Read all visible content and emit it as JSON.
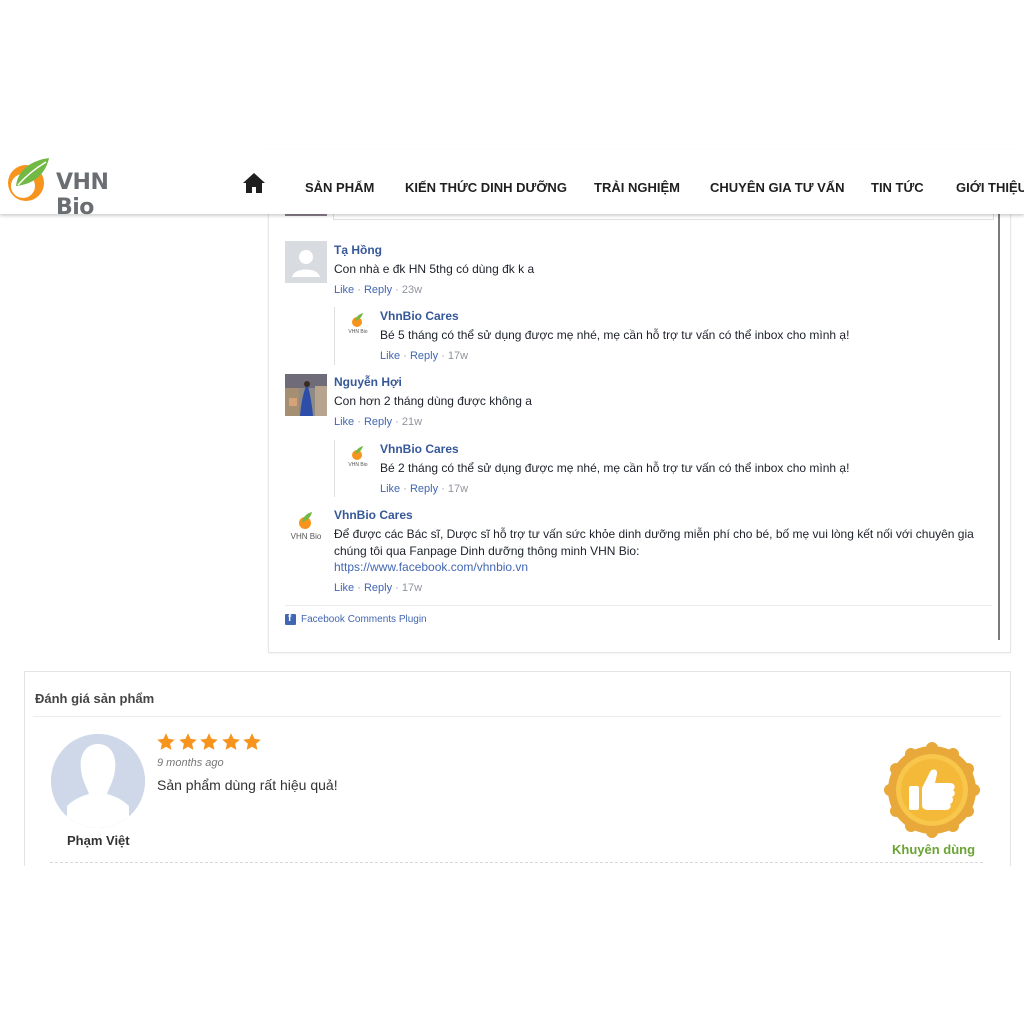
{
  "brand": {
    "name": "VHN Bio",
    "accent_orange": "#f7941d",
    "accent_green": "#72b844"
  },
  "nav": {
    "home_icon": "home-icon",
    "items": [
      "SẢN PHẨM",
      "KIẾN THỨC DINH DƯỠNG",
      "TRẢI NGHIỆM",
      "CHUYÊN GIA TƯ VẤN",
      "TIN TỨC",
      "GIỚI THIỆU"
    ]
  },
  "comments": [
    {
      "name": "Tạ Hồng",
      "text": "Con nhà e đk HN 5thg có dùng đk k a",
      "like": "Like",
      "reply": "Reply",
      "sep": "·",
      "time": "23w",
      "replies": [
        {
          "name": "VhnBio Cares",
          "text": "Bé 5 tháng có thể sử dụng được mẹ nhé, mẹ cần hỗ trợ tư vấn có thể inbox cho mình ạ!",
          "like": "Like",
          "reply": "Reply",
          "sep": "·",
          "time": "17w"
        }
      ]
    },
    {
      "name": "Nguyễn Hợi",
      "text": "Con hơn 2 tháng dùng được không a",
      "like": "Like",
      "reply": "Reply",
      "sep": "·",
      "time": "21w",
      "replies": [
        {
          "name": "VhnBio Cares",
          "text": "Bé 2 tháng có thể sử dụng được mẹ nhé, mẹ cần hỗ trợ tư vấn có thể inbox cho mình ạ!",
          "like": "Like",
          "reply": "Reply",
          "sep": "·",
          "time": "17w"
        }
      ]
    },
    {
      "name": "VhnBio Cares",
      "text_line1": "Để được các Bác sĩ, Dược sĩ hỗ trợ tư vấn sức khỏe dinh dưỡng miễn phí cho bé, bố mẹ vui lòng kết nối với chuyên gia",
      "text_line2": "chúng tôi qua Fanpage Dinh dưỡng thông minh VHN Bio:",
      "link": "https://www.facebook.com/vhnbio.vn",
      "like": "Like",
      "reply": "Reply",
      "sep": "·",
      "time": "17w"
    }
  ],
  "fb_plugin": {
    "label": "Facebook Comments Plugin",
    "icon": "facebook-icon"
  },
  "rating": {
    "title": "Đánh giá sản phẩm",
    "review": {
      "reviewer": "Phạm Việt",
      "stars": 5,
      "max_stars": 5,
      "time": "9 months ago",
      "text": "Sản phẩm dùng rất hiệu quả!"
    },
    "badge_label": "Khuyên dùng",
    "badge_icon": "thumbs-up-badge-icon",
    "star_color": "#f7941d"
  }
}
